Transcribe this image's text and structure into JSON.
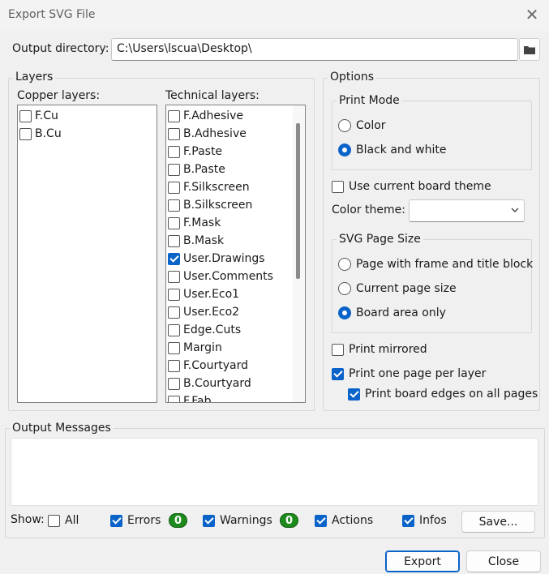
{
  "window": {
    "title": "Export SVG File"
  },
  "output_directory": {
    "label": "Output directory:",
    "value": "C:\\Users\\lscua\\Desktop\\"
  },
  "layers": {
    "title": "Layers",
    "copper_label": "Copper layers:",
    "copper": [
      {
        "name": "F.Cu",
        "checked": false
      },
      {
        "name": "B.Cu",
        "checked": false
      }
    ],
    "technical_label": "Technical layers:",
    "technical": [
      {
        "name": "F.Adhesive",
        "checked": false
      },
      {
        "name": "B.Adhesive",
        "checked": false
      },
      {
        "name": "F.Paste",
        "checked": false
      },
      {
        "name": "B.Paste",
        "checked": false
      },
      {
        "name": "F.Silkscreen",
        "checked": false
      },
      {
        "name": "B.Silkscreen",
        "checked": false
      },
      {
        "name": "F.Mask",
        "checked": false
      },
      {
        "name": "B.Mask",
        "checked": false
      },
      {
        "name": "User.Drawings",
        "checked": true
      },
      {
        "name": "User.Comments",
        "checked": false
      },
      {
        "name": "User.Eco1",
        "checked": false
      },
      {
        "name": "User.Eco2",
        "checked": false
      },
      {
        "name": "Edge.Cuts",
        "checked": false
      },
      {
        "name": "Margin",
        "checked": false
      },
      {
        "name": "F.Courtyard",
        "checked": false
      },
      {
        "name": "B.Courtyard",
        "checked": false
      },
      {
        "name": "F.Fab",
        "checked": false
      }
    ]
  },
  "options": {
    "title": "Options",
    "print_mode": {
      "title": "Print Mode",
      "color": "Color",
      "bw": "Black and white",
      "selected": "bw"
    },
    "use_board_theme": {
      "label": "Use current board theme",
      "checked": false
    },
    "color_theme": {
      "label": "Color theme:",
      "value": ""
    },
    "page_size": {
      "title": "SVG Page Size",
      "frame": "Page with frame and title block",
      "current": "Current page size",
      "board": "Board area only",
      "selected": "board"
    },
    "print_mirrored": {
      "label": "Print mirrored",
      "checked": false
    },
    "one_page_per_layer": {
      "label": "Print one page per layer",
      "checked": true
    },
    "board_edges_all_pages": {
      "label": "Print board edges on all pages",
      "checked": true
    }
  },
  "messages": {
    "title": "Output Messages",
    "show_label": "Show:",
    "all": {
      "label": "All",
      "checked": false
    },
    "errors": {
      "label": "Errors",
      "checked": true,
      "count": "0"
    },
    "warnings": {
      "label": "Warnings",
      "checked": true,
      "count": "0"
    },
    "actions": {
      "label": "Actions",
      "checked": true
    },
    "infos": {
      "label": "Infos",
      "checked": true
    },
    "save_label": "Save..."
  },
  "buttons": {
    "export": "Export",
    "close": "Close"
  },
  "colors": {
    "accent": "#0a63c9",
    "badge_green": "#1e8a1e"
  }
}
